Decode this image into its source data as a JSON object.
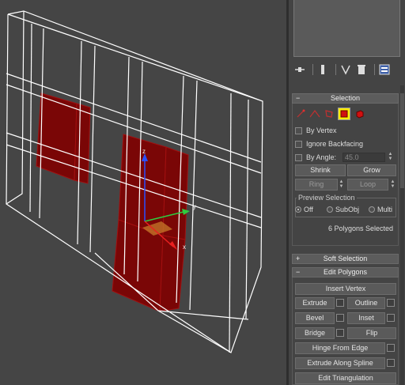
{
  "viewport": {
    "axis_labels": {
      "x": "x",
      "y": "y",
      "z": "z"
    }
  },
  "toolbar": {
    "icons": [
      "pin-stack-icon",
      "show-end-result-icon",
      "make-unique-icon",
      "remove-modifier-icon",
      "configure-modifier-sets-icon"
    ]
  },
  "selection": {
    "title": "Selection",
    "subobject_modes": [
      "vertex-mode-icon",
      "edge-mode-icon",
      "border-mode-icon",
      "polygon-mode-icon",
      "element-mode-icon"
    ],
    "active_mode": "polygon-mode-icon",
    "by_vertex": "By Vertex",
    "ignore_backfacing": "Ignore Backfacing",
    "by_angle": "By Angle:",
    "by_angle_value": "45.0",
    "shrink": "Shrink",
    "grow": "Grow",
    "ring": "Ring",
    "loop": "Loop",
    "preview_group": "Preview Selection",
    "preview_off": "Off",
    "preview_subobj": "SubObj",
    "preview_multi": "Multi",
    "status": "6 Polygons Selected"
  },
  "soft_selection": {
    "title": "Soft Selection"
  },
  "edit_polygons": {
    "title": "Edit Polygons",
    "insert_vertex": "Insert Vertex",
    "extrude": "Extrude",
    "outline": "Outline",
    "bevel": "Bevel",
    "inset": "Inset",
    "bridge": "Bridge",
    "flip": "Flip",
    "hinge_from_edge": "Hinge From Edge",
    "extrude_along_spline": "Extrude Along Spline",
    "edit_triangulation": "Edit Triangulation"
  },
  "colors": {
    "accent_selected": "#ffee00",
    "polygon_selected": "#8b0000",
    "wire": "#ffffff"
  }
}
